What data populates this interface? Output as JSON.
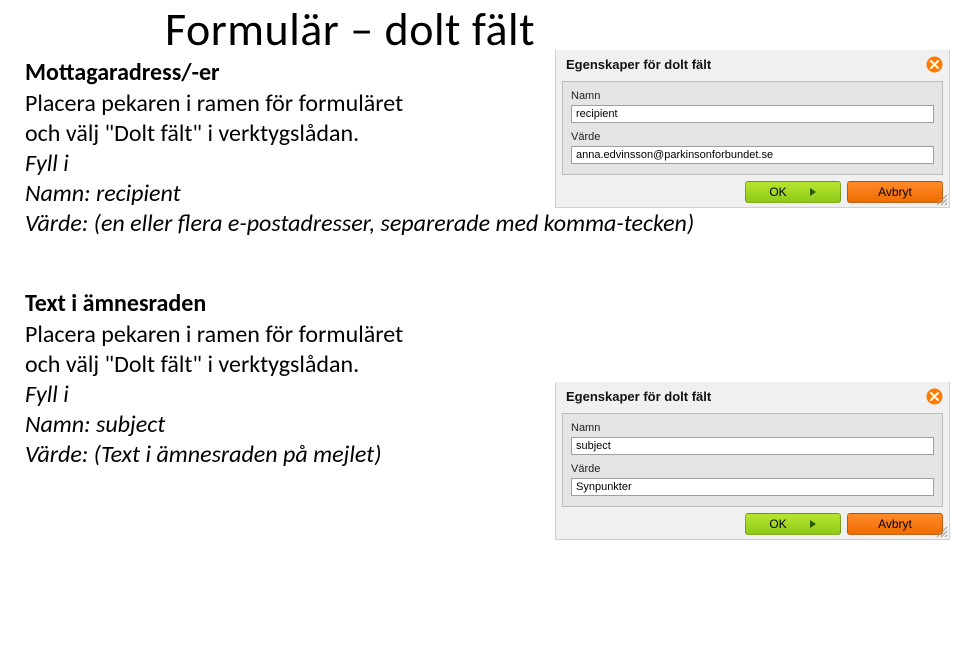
{
  "title": "Formulär – dolt fält",
  "section1": {
    "heading": "Mottagaradress/-er",
    "line1": "Placera pekaren i ramen för formuläret",
    "line2": "och välj \"Dolt fält\" i verktygslådan.",
    "fill_label": "Fyll i",
    "name_line": "Namn: recipient",
    "value_line": "Värde: (en eller flera e-postadresser, separerade med komma-tecken)"
  },
  "section2": {
    "heading": "Text i ämnesraden",
    "line1": "Placera pekaren i ramen för formuläret",
    "line2": "och välj \"Dolt fält\" i verktygslådan.",
    "fill_label": "Fyll i",
    "name_line": "Namn: subject",
    "value_line": "Värde: (Text i ämnesraden på mejlet)"
  },
  "dialog1": {
    "title": "Egenskaper för dolt fält",
    "name_label": "Namn",
    "name_value": "recipient",
    "value_label": "Värde",
    "value_value": "anna.edvinsson@parkinsonforbundet.se",
    "ok_label": "OK",
    "cancel_label": "Avbryt"
  },
  "dialog2": {
    "title": "Egenskaper för dolt fält",
    "name_label": "Namn",
    "name_value": "subject",
    "value_label": "Värde",
    "value_value": "Synpunkter",
    "ok_label": "OK",
    "cancel_label": "Avbryt"
  },
  "colors": {
    "ok_green_top": "#b6e62f",
    "ok_green_bot": "#8ec91a",
    "cancel_orange_top": "#ff8a2a",
    "cancel_orange_bot": "#f06c00",
    "close_orange": "#ff7a00"
  }
}
